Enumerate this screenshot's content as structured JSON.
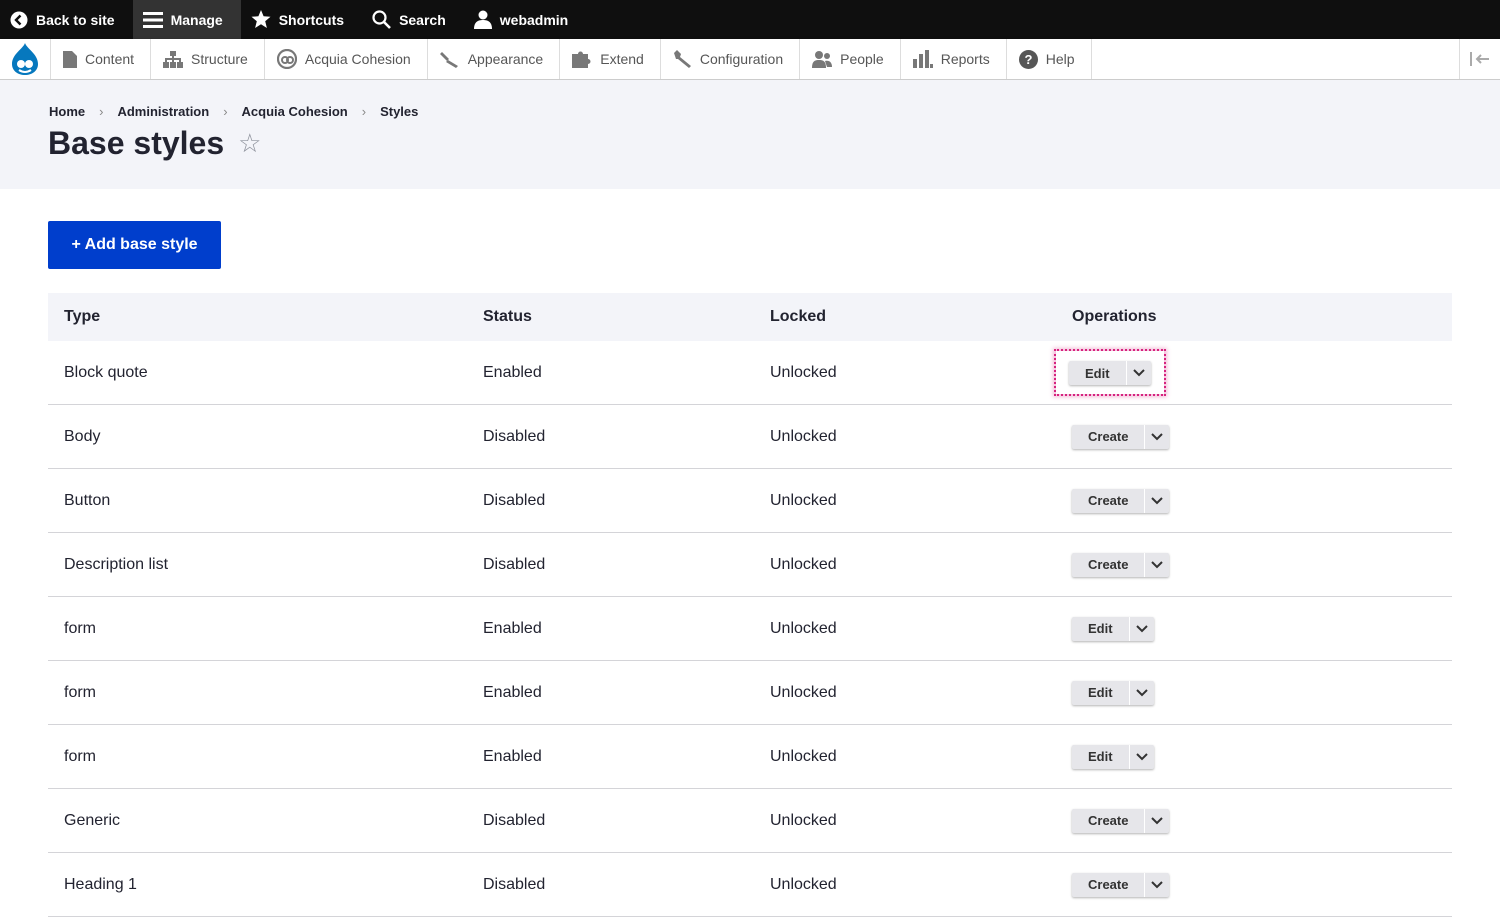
{
  "toolbar": {
    "back": "Back to site",
    "manage": "Manage",
    "shortcuts": "Shortcuts",
    "search": "Search",
    "user": "webadmin"
  },
  "tray": {
    "items": [
      "Content",
      "Structure",
      "Acquia Cohesion",
      "Appearance",
      "Extend",
      "Configuration",
      "People",
      "Reports",
      "Help"
    ]
  },
  "breadcrumb": [
    "Home",
    "Administration",
    "Acquia Cohesion",
    "Styles"
  ],
  "page": {
    "title": "Base styles",
    "star": "☆",
    "add_button": "+ Add base style"
  },
  "table": {
    "headers": [
      "Type",
      "Status",
      "Locked",
      "Operations"
    ],
    "rows": [
      {
        "type": "Block quote",
        "status": "Enabled",
        "locked": "Unlocked",
        "op": "Edit"
      },
      {
        "type": "Body",
        "status": "Disabled",
        "locked": "Unlocked",
        "op": "Create"
      },
      {
        "type": "Button",
        "status": "Disabled",
        "locked": "Unlocked",
        "op": "Create"
      },
      {
        "type": "Description list",
        "status": "Disabled",
        "locked": "Unlocked",
        "op": "Create"
      },
      {
        "type": "form",
        "status": "Enabled",
        "locked": "Unlocked",
        "op": "Edit"
      },
      {
        "type": "form",
        "status": "Enabled",
        "locked": "Unlocked",
        "op": "Edit"
      },
      {
        "type": "form",
        "status": "Enabled",
        "locked": "Unlocked",
        "op": "Edit"
      },
      {
        "type": "Generic",
        "status": "Disabled",
        "locked": "Unlocked",
        "op": "Create"
      },
      {
        "type": "Heading 1",
        "status": "Disabled",
        "locked": "Unlocked",
        "op": "Create"
      }
    ]
  },
  "colors": {
    "accent": "#003ecc",
    "focus": "#d6237f",
    "toolbar": "#0f0f0f"
  }
}
